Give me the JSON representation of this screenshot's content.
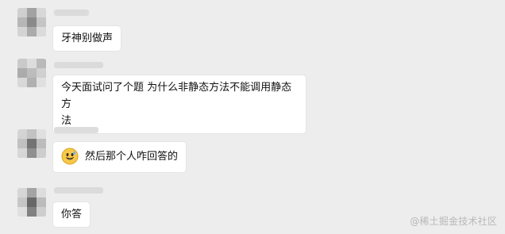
{
  "colors": {
    "background": "#ededed",
    "bubble": "#ffffff",
    "text": "#111111",
    "watermark": "#b8b8b8"
  },
  "messages": [
    {
      "text": "牙神别做声"
    },
    {
      "text": "今天面试问了个题 为什么非静态方法不能调用静态方\n法"
    },
    {
      "emoji": "grinning-sweat-emoji",
      "text": "然后那个人咋回答的"
    },
    {
      "text": "你答"
    }
  ],
  "watermark": {
    "text": "@稀土掘金技术社区"
  }
}
